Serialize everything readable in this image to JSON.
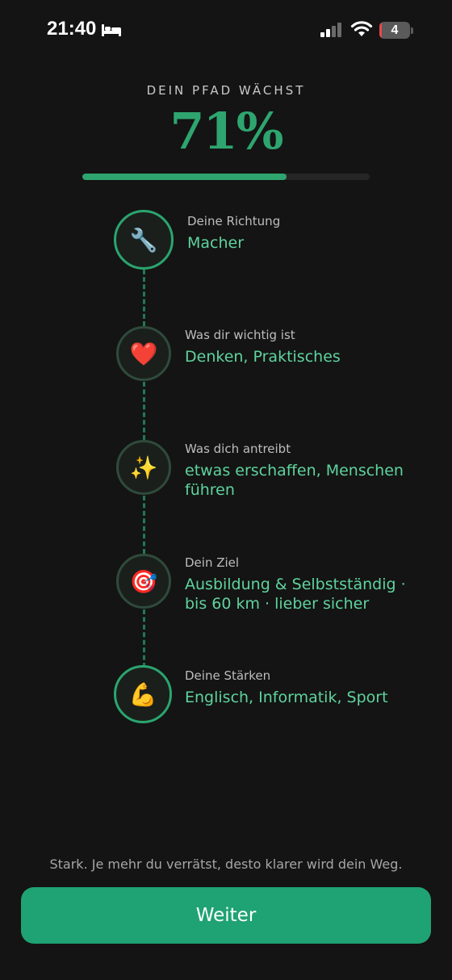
{
  "status": {
    "time": "21:40",
    "battery_level": "4",
    "icons": [
      "bed-icon",
      "signal-icon",
      "wifi-icon",
      "battery-icon"
    ]
  },
  "header": {
    "kicker": "DEIN PFAD WÄCHST",
    "percent": "71%",
    "progress": 0.71
  },
  "steps": [
    {
      "icon": "wrench-icon",
      "glyph": "🔧",
      "label": "Deine Richtung",
      "value": "Macher"
    },
    {
      "icon": "heart-icon",
      "glyph": "❤️",
      "label": "Was dir wichtig ist",
      "value": "Denken, Praktisches"
    },
    {
      "icon": "sparkles-icon",
      "glyph": "✨",
      "label": "Was dich antreibt",
      "value": "etwas erschaffen, Menschen führen"
    },
    {
      "icon": "target-icon",
      "glyph": "🎯",
      "label": "Dein Ziel",
      "value": "Ausbildung & Selbstständig · bis 60 km · lieber sicher"
    },
    {
      "icon": "flexed-biceps-icon",
      "glyph": "💪",
      "label": "Deine Stärken",
      "value": "Englisch, Informatik, Sport"
    }
  ],
  "footer": {
    "hint": "Stark. Je mehr du verrätst, desto klarer wird dein Weg.",
    "button_label": "Weiter"
  },
  "colors": {
    "background": "#141414",
    "accent": "#2ea56f",
    "value_text": "#5fd39d",
    "button": "#1fa274"
  }
}
